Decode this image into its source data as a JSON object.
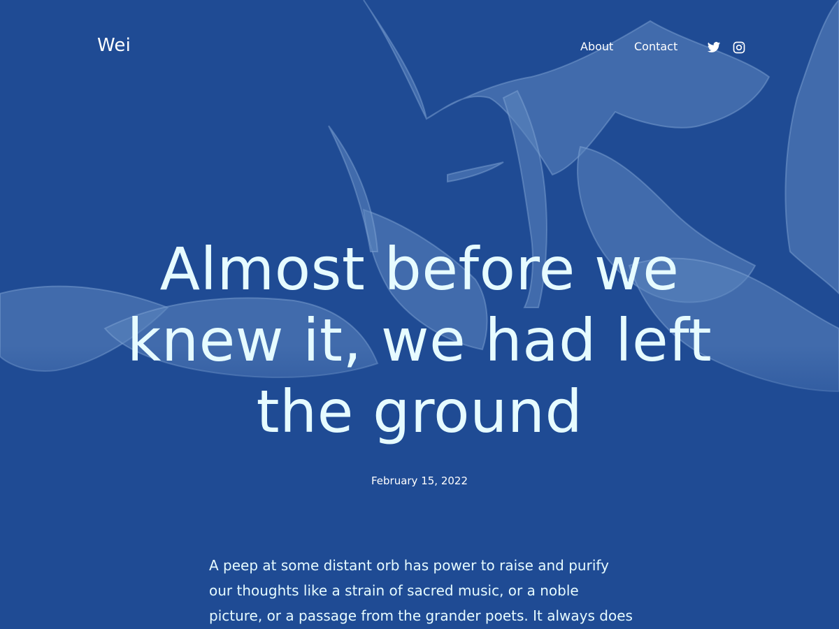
{
  "site": {
    "title": "Wei"
  },
  "nav": {
    "items": [
      {
        "label": "About"
      },
      {
        "label": "Contact"
      }
    ],
    "social": [
      {
        "icon": "twitter-icon"
      },
      {
        "icon": "instagram-icon"
      }
    ]
  },
  "post": {
    "title": "Almost before we knew it, we had left the ground",
    "date": "February 15, 2022",
    "excerpt": "A peep at some distant orb has power to raise and purify our thoughts like a strain of sacred music, or a noble picture, or a passage from the grander poets. It always does one good."
  },
  "colors": {
    "background": "#1f4b94",
    "text": "#e6fbff",
    "art": "#6f95c9"
  }
}
